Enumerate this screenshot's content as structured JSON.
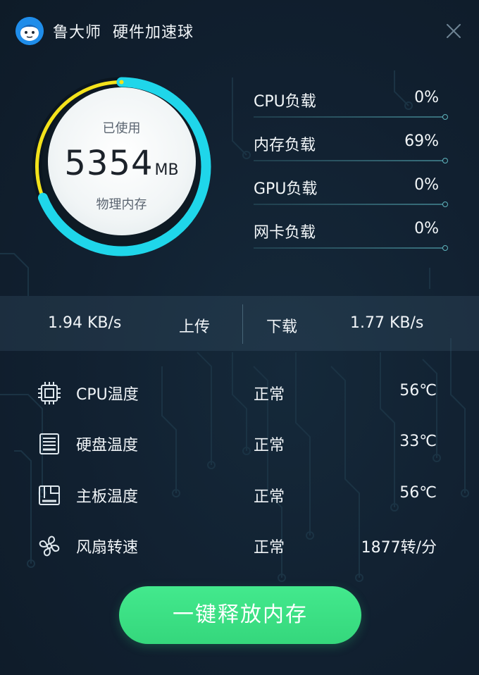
{
  "app": {
    "name": "鲁大师",
    "title": "硬件加速球",
    "icons": {
      "logo": "ludashi-logo-icon",
      "close": "close-icon"
    }
  },
  "memory": {
    "used_label": "已使用",
    "value": "5354",
    "unit": "MB",
    "sub_label": "物理内存",
    "usage_fraction": 0.69,
    "colors": {
      "ring": "#1fd6ea",
      "ring_highlight": "#f3e21b",
      "track": "#0b1620"
    }
  },
  "loads": [
    {
      "label": "CPU负载",
      "value": "0%"
    },
    {
      "label": "内存负载",
      "value": "69%"
    },
    {
      "label": "GPU负载",
      "value": "0%"
    },
    {
      "label": "网卡负载",
      "value": "0%"
    }
  ],
  "network": {
    "upload_speed": "1.94 KB/s",
    "upload_label": "上传",
    "download_label": "下载",
    "download_speed": "1.77 KB/s"
  },
  "temps": [
    {
      "icon": "cpu-chip-icon",
      "label": "CPU温度",
      "status": "正常",
      "value": "56℃"
    },
    {
      "icon": "hard-disk-icon",
      "label": "硬盘温度",
      "status": "正常",
      "value": "33℃"
    },
    {
      "icon": "motherboard-icon",
      "label": "主板温度",
      "status": "正常",
      "value": "56℃"
    },
    {
      "icon": "fan-icon",
      "label": "风扇转速",
      "status": "正常",
      "value": "1877转/分"
    }
  ],
  "release_button": {
    "label": "一键释放内存",
    "color": "#3ee286"
  }
}
